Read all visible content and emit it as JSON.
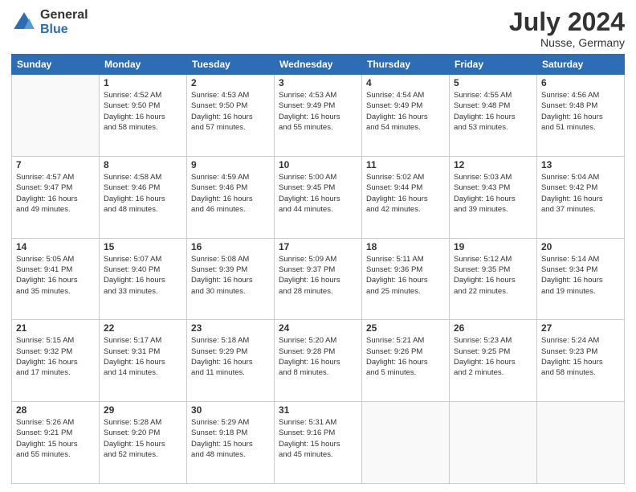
{
  "header": {
    "logo_general": "General",
    "logo_blue": "Blue",
    "month": "July 2024",
    "location": "Nusse, Germany"
  },
  "days_of_week": [
    "Sunday",
    "Monday",
    "Tuesday",
    "Wednesday",
    "Thursday",
    "Friday",
    "Saturday"
  ],
  "weeks": [
    [
      {
        "day": "",
        "info": ""
      },
      {
        "day": "1",
        "info": "Sunrise: 4:52 AM\nSunset: 9:50 PM\nDaylight: 16 hours\nand 58 minutes."
      },
      {
        "day": "2",
        "info": "Sunrise: 4:53 AM\nSunset: 9:50 PM\nDaylight: 16 hours\nand 57 minutes."
      },
      {
        "day": "3",
        "info": "Sunrise: 4:53 AM\nSunset: 9:49 PM\nDaylight: 16 hours\nand 55 minutes."
      },
      {
        "day": "4",
        "info": "Sunrise: 4:54 AM\nSunset: 9:49 PM\nDaylight: 16 hours\nand 54 minutes."
      },
      {
        "day": "5",
        "info": "Sunrise: 4:55 AM\nSunset: 9:48 PM\nDaylight: 16 hours\nand 53 minutes."
      },
      {
        "day": "6",
        "info": "Sunrise: 4:56 AM\nSunset: 9:48 PM\nDaylight: 16 hours\nand 51 minutes."
      }
    ],
    [
      {
        "day": "7",
        "info": "Sunrise: 4:57 AM\nSunset: 9:47 PM\nDaylight: 16 hours\nand 49 minutes."
      },
      {
        "day": "8",
        "info": "Sunrise: 4:58 AM\nSunset: 9:46 PM\nDaylight: 16 hours\nand 48 minutes."
      },
      {
        "day": "9",
        "info": "Sunrise: 4:59 AM\nSunset: 9:46 PM\nDaylight: 16 hours\nand 46 minutes."
      },
      {
        "day": "10",
        "info": "Sunrise: 5:00 AM\nSunset: 9:45 PM\nDaylight: 16 hours\nand 44 minutes."
      },
      {
        "day": "11",
        "info": "Sunrise: 5:02 AM\nSunset: 9:44 PM\nDaylight: 16 hours\nand 42 minutes."
      },
      {
        "day": "12",
        "info": "Sunrise: 5:03 AM\nSunset: 9:43 PM\nDaylight: 16 hours\nand 39 minutes."
      },
      {
        "day": "13",
        "info": "Sunrise: 5:04 AM\nSunset: 9:42 PM\nDaylight: 16 hours\nand 37 minutes."
      }
    ],
    [
      {
        "day": "14",
        "info": "Sunrise: 5:05 AM\nSunset: 9:41 PM\nDaylight: 16 hours\nand 35 minutes."
      },
      {
        "day": "15",
        "info": "Sunrise: 5:07 AM\nSunset: 9:40 PM\nDaylight: 16 hours\nand 33 minutes."
      },
      {
        "day": "16",
        "info": "Sunrise: 5:08 AM\nSunset: 9:39 PM\nDaylight: 16 hours\nand 30 minutes."
      },
      {
        "day": "17",
        "info": "Sunrise: 5:09 AM\nSunset: 9:37 PM\nDaylight: 16 hours\nand 28 minutes."
      },
      {
        "day": "18",
        "info": "Sunrise: 5:11 AM\nSunset: 9:36 PM\nDaylight: 16 hours\nand 25 minutes."
      },
      {
        "day": "19",
        "info": "Sunrise: 5:12 AM\nSunset: 9:35 PM\nDaylight: 16 hours\nand 22 minutes."
      },
      {
        "day": "20",
        "info": "Sunrise: 5:14 AM\nSunset: 9:34 PM\nDaylight: 16 hours\nand 19 minutes."
      }
    ],
    [
      {
        "day": "21",
        "info": "Sunrise: 5:15 AM\nSunset: 9:32 PM\nDaylight: 16 hours\nand 17 minutes."
      },
      {
        "day": "22",
        "info": "Sunrise: 5:17 AM\nSunset: 9:31 PM\nDaylight: 16 hours\nand 14 minutes."
      },
      {
        "day": "23",
        "info": "Sunrise: 5:18 AM\nSunset: 9:29 PM\nDaylight: 16 hours\nand 11 minutes."
      },
      {
        "day": "24",
        "info": "Sunrise: 5:20 AM\nSunset: 9:28 PM\nDaylight: 16 hours\nand 8 minutes."
      },
      {
        "day": "25",
        "info": "Sunrise: 5:21 AM\nSunset: 9:26 PM\nDaylight: 16 hours\nand 5 minutes."
      },
      {
        "day": "26",
        "info": "Sunrise: 5:23 AM\nSunset: 9:25 PM\nDaylight: 16 hours\nand 2 minutes."
      },
      {
        "day": "27",
        "info": "Sunrise: 5:24 AM\nSunset: 9:23 PM\nDaylight: 15 hours\nand 58 minutes."
      }
    ],
    [
      {
        "day": "28",
        "info": "Sunrise: 5:26 AM\nSunset: 9:21 PM\nDaylight: 15 hours\nand 55 minutes."
      },
      {
        "day": "29",
        "info": "Sunrise: 5:28 AM\nSunset: 9:20 PM\nDaylight: 15 hours\nand 52 minutes."
      },
      {
        "day": "30",
        "info": "Sunrise: 5:29 AM\nSunset: 9:18 PM\nDaylight: 15 hours\nand 48 minutes."
      },
      {
        "day": "31",
        "info": "Sunrise: 5:31 AM\nSunset: 9:16 PM\nDaylight: 15 hours\nand 45 minutes."
      },
      {
        "day": "",
        "info": ""
      },
      {
        "day": "",
        "info": ""
      },
      {
        "day": "",
        "info": ""
      }
    ]
  ]
}
